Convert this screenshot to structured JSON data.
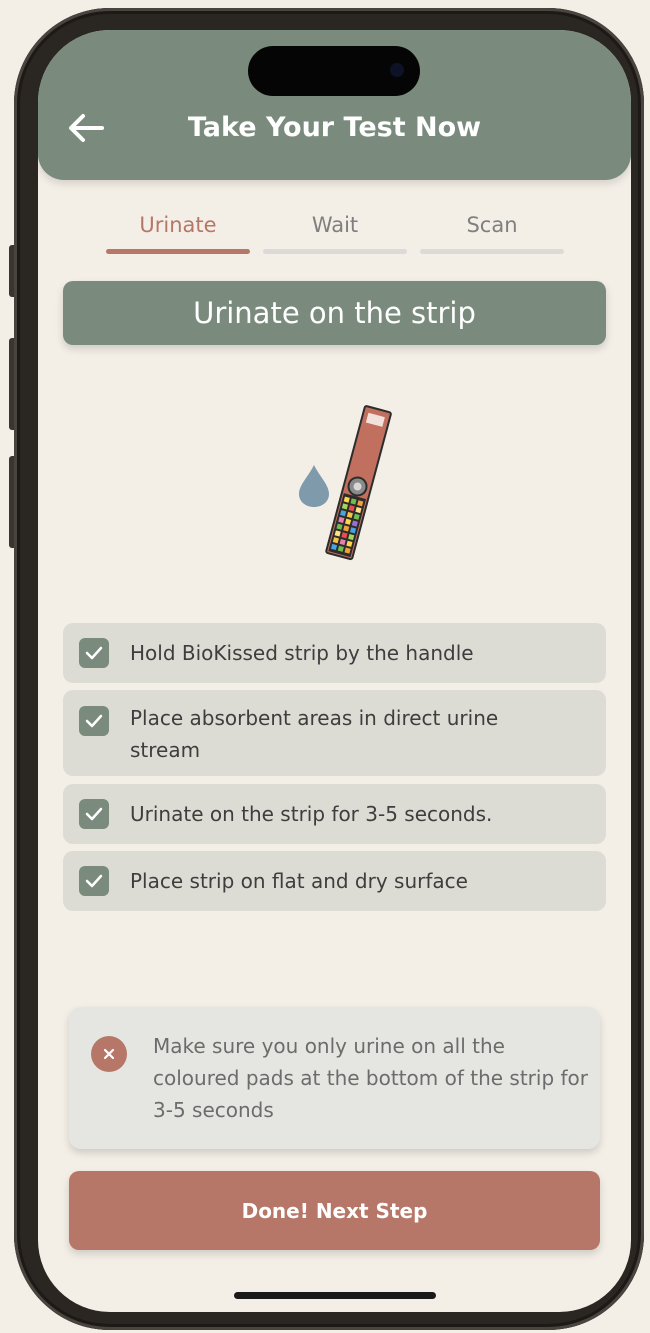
{
  "header": {
    "title": "Take Your Test Now",
    "back_icon": "arrow-left-icon"
  },
  "tabs": [
    {
      "label": "Urinate",
      "active": true
    },
    {
      "label": "Wait",
      "active": false
    },
    {
      "label": "Scan",
      "active": false
    }
  ],
  "step_banner": "Urinate on the strip",
  "illustration": {
    "icons": [
      "droplet-icon",
      "test-strip-icon"
    ]
  },
  "checklist": [
    {
      "text": "Hold BioKissed strip by the handle",
      "checked": true
    },
    {
      "text": "Place absorbent areas in direct urine stream",
      "checked": true
    },
    {
      "text": "Urinate on the strip for 3-5 seconds.",
      "checked": true
    },
    {
      "text": "Place strip on flat and dry surface",
      "checked": true
    }
  ],
  "warning": {
    "icon": "close-circle-icon",
    "text": "Make sure you only urine on all the coloured pads at the bottom of the strip for 3-5 seconds"
  },
  "cta": {
    "label": "Done! Next Step"
  },
  "colors": {
    "header": "#7a8b7e",
    "accent": "#b67768",
    "background": "#f3efe7",
    "checklist_item": "#dcdcd4",
    "warning_bg": "#e5e6e2"
  }
}
